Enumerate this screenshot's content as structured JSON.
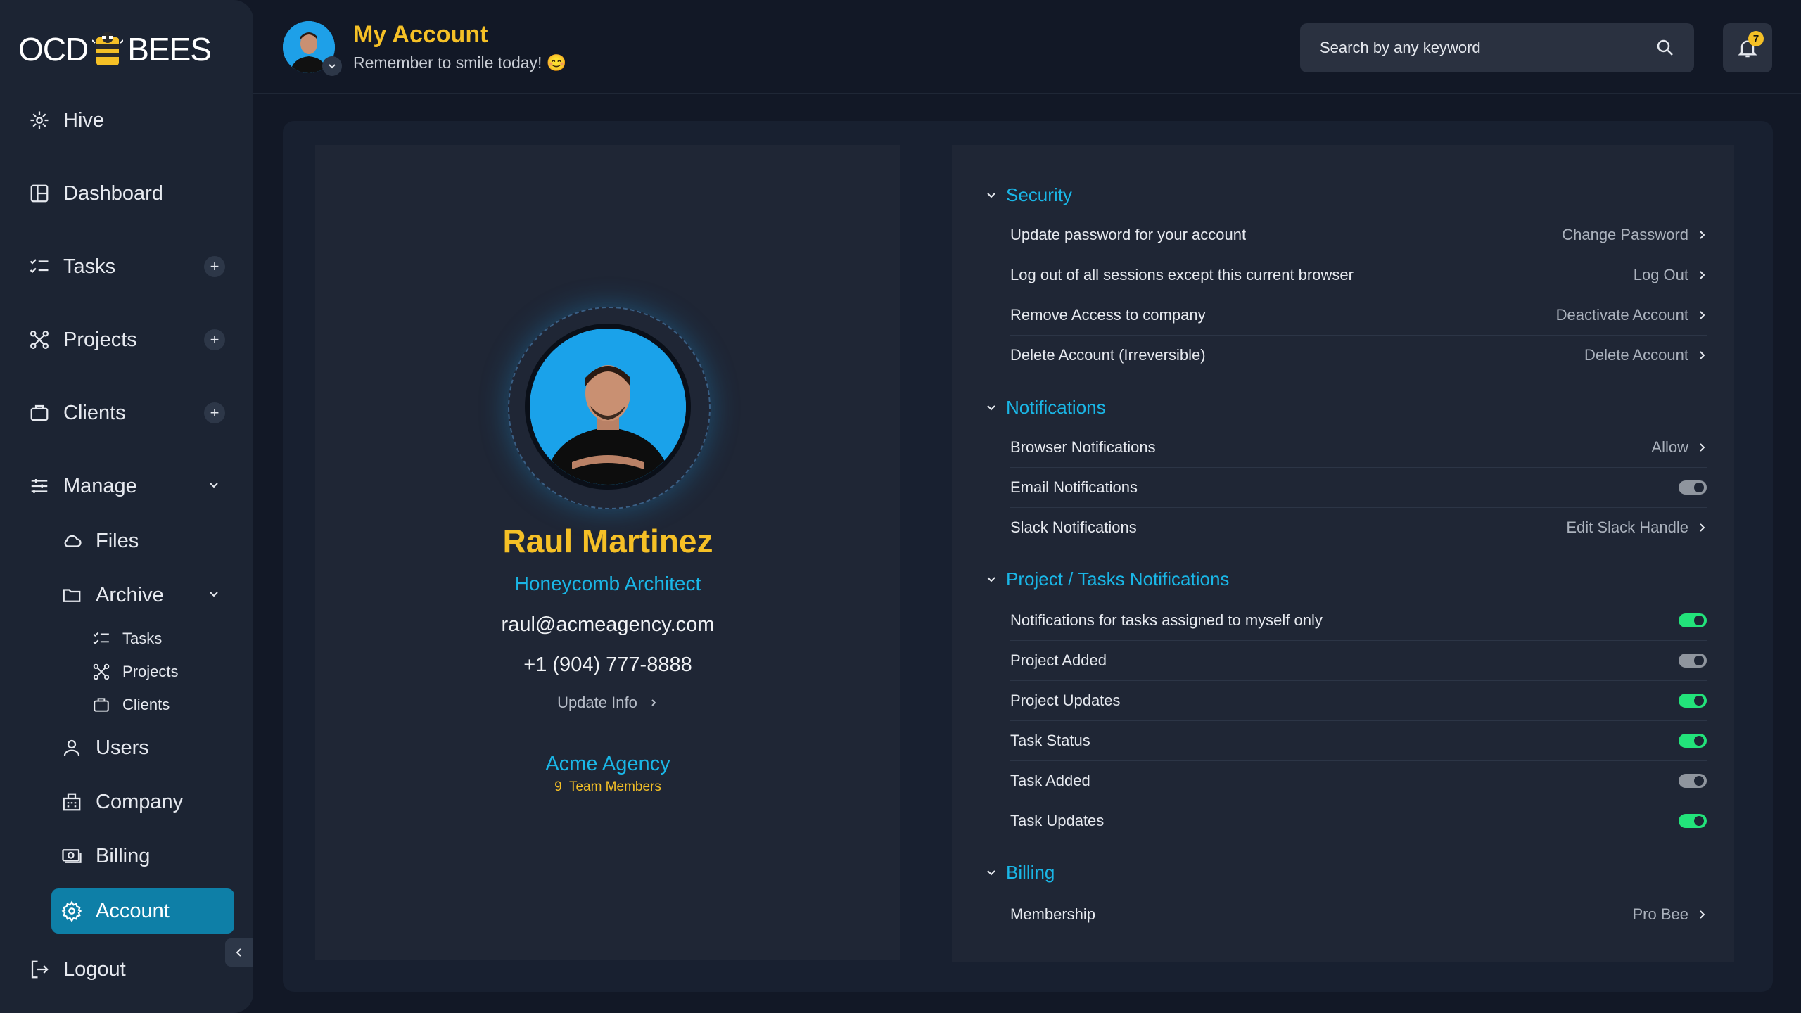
{
  "brand": {
    "logo_left": "OCD",
    "logo_right": "BEES"
  },
  "sidebar": {
    "items": [
      {
        "label": "Hive",
        "icon": "hive-icon"
      },
      {
        "label": "Dashboard",
        "icon": "dashboard-icon"
      },
      {
        "label": "Tasks",
        "icon": "tasks-icon"
      },
      {
        "label": "Projects",
        "icon": "projects-icon"
      },
      {
        "label": "Clients",
        "icon": "clients-icon"
      },
      {
        "label": "Manage",
        "icon": "manage-icon"
      }
    ],
    "manage_items": {
      "files": "Files",
      "archive": "Archive",
      "archive_tasks": "Tasks",
      "archive_projects": "Projects",
      "archive_clients": "Clients",
      "users": "Users",
      "company": "Company",
      "billing": "Billing",
      "account": "Account"
    },
    "logout": "Logout"
  },
  "header": {
    "title": "My Account",
    "subtitle": "Remember to smile today! 😊",
    "search_placeholder": "Search by any keyword",
    "notification_count": "7"
  },
  "profile": {
    "name": "Raul Martinez",
    "role": "Honeycomb Architect",
    "email": "raul@acmeagency.com",
    "phone": "+1 (904) 777-8888",
    "update_label": "Update Info",
    "company": "Acme Agency",
    "team_count": "9",
    "team_label": "Team Members"
  },
  "settings": {
    "security": {
      "title": "Security",
      "rows": [
        {
          "label": "Update password for your account",
          "action": "Change Password"
        },
        {
          "label": "Log out of all sessions except this current browser",
          "action": "Log Out"
        },
        {
          "label": "Remove Access to company",
          "action": "Deactivate Account"
        },
        {
          "label": "Delete Account (Irreversible)",
          "action": "Delete Account"
        }
      ]
    },
    "notifications": {
      "title": "Notifications",
      "rows": [
        {
          "label": "Browser Notifications",
          "action": "Allow"
        },
        {
          "label": "Email Notifications",
          "toggle": "off"
        },
        {
          "label": "Slack Notifications",
          "action": "Edit Slack Handle"
        }
      ]
    },
    "project_tasks": {
      "title": "Project / Tasks Notifications",
      "rows": [
        {
          "label": "Notifications for tasks assigned to myself only",
          "toggle": "on"
        },
        {
          "label": "Project Added",
          "toggle": "off"
        },
        {
          "label": "Project Updates",
          "toggle": "on"
        },
        {
          "label": "Task Status",
          "toggle": "on"
        },
        {
          "label": "Task Added",
          "toggle": "off"
        },
        {
          "label": "Task Updates",
          "toggle": "on"
        }
      ]
    },
    "billing": {
      "title": "Billing",
      "rows": [
        {
          "label": "Membership",
          "action": "Pro Bee"
        }
      ]
    }
  },
  "colors": {
    "accent_yellow": "#f5c026",
    "accent_cyan": "#1ab6e6",
    "toggle_on": "#22e37a",
    "active_nav": "#0e7fa7"
  }
}
